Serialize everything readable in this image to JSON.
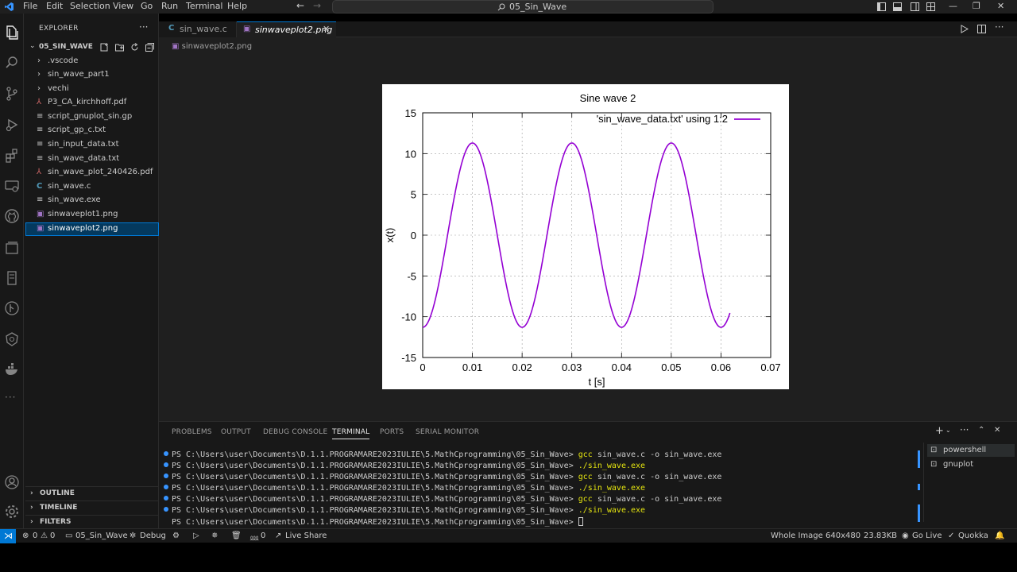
{
  "menu": [
    "File",
    "Edit",
    "Selection",
    "View",
    "Go",
    "Run",
    "Terminal",
    "Help"
  ],
  "title": "05_Sin_Wave",
  "explorer": {
    "header": "EXPLORER",
    "folder": "05_SIN_WAVE",
    "items": [
      {
        "label": ".vscode",
        "kind": "folder"
      },
      {
        "label": "sin_wave_part1",
        "kind": "folder"
      },
      {
        "label": "vechi",
        "kind": "folder"
      },
      {
        "label": "P3_CA_kirchhoff.pdf",
        "kind": "pdf"
      },
      {
        "label": "script_gnuplot_sin.gp",
        "kind": "text"
      },
      {
        "label": "script_gp_c.txt",
        "kind": "text"
      },
      {
        "label": "sin_input_data.txt",
        "kind": "text"
      },
      {
        "label": "sin_wave_data.txt",
        "kind": "text"
      },
      {
        "label": "sin_wave_plot_240426.pdf",
        "kind": "pdf"
      },
      {
        "label": "sin_wave.c",
        "kind": "c"
      },
      {
        "label": "sin_wave.exe",
        "kind": "text"
      },
      {
        "label": "sinwaveplot1.png",
        "kind": "image"
      },
      {
        "label": "sinwaveplot2.png",
        "kind": "image",
        "selected": true
      }
    ],
    "sections": [
      "OUTLINE",
      "TIMELINE",
      "FILTERS"
    ]
  },
  "tabs": [
    {
      "label": "sin_wave.c",
      "icon": "C"
    },
    {
      "label": "sinwaveplot2.png",
      "active": true
    }
  ],
  "breadcrumb": "sinwaveplot2.png",
  "chart_data": {
    "type": "line",
    "title": "Sine wave 2",
    "xlabel": "t [s]",
    "ylabel": "x(t)",
    "xlim": [
      0,
      0.07
    ],
    "ylim": [
      -15,
      15
    ],
    "xticks": [
      "0",
      "0.01",
      "0.02",
      "0.03",
      "0.04",
      "0.05",
      "0.06",
      "0.07"
    ],
    "yticks": [
      "15",
      "10",
      "5",
      "0",
      "-5",
      "-10",
      "-15"
    ],
    "grid": true,
    "legend_position": "top-right",
    "series": [
      {
        "name": "'sin_wave_data.txt' using 1:2",
        "color": "#9400d3",
        "amplitude": 11.3,
        "period": 0.02,
        "phase_start_value": -11.3,
        "x_end": 0.0618,
        "y_end": -9.0
      }
    ]
  },
  "panel_tabs": [
    "PROBLEMS",
    "OUTPUT",
    "DEBUG CONSOLE",
    "TERMINAL",
    "PORTS",
    "SERIAL MONITOR"
  ],
  "terminal": {
    "prompt": "PS C:\\Users\\user\\Documents\\D.1.1.PROGRAMARE2023IULIE\\5.MathCprogramming\\05_Sin_Wave>",
    "lines": [
      {
        "cmd": "gcc",
        "rest": " sin_wave.c -o sin_wave.exe"
      },
      {
        "cmd": "./sin_wave.exe",
        "rest": ""
      },
      {
        "cmd": "gcc",
        "rest": " sin_wave.c -o sin_wave.exe"
      },
      {
        "cmd": "./sin_wave.exe",
        "rest": ""
      },
      {
        "cmd": "gcc",
        "rest": " sin_wave.c -o sin_wave.exe"
      },
      {
        "cmd": "./sin_wave.exe",
        "rest": ""
      },
      {
        "cmd": "",
        "rest": ""
      }
    ],
    "sessions": [
      "powershell",
      "gnuplot"
    ]
  },
  "status": {
    "errors": "0",
    "warnings": "0",
    "workspace": "05_Sin_Wave",
    "debug": "Debug",
    "ports": "0",
    "live_share": "Live Share",
    "zoom": "Whole Image",
    "dimensions": "640x480",
    "size": "23.83KB",
    "go_live": "Go Live",
    "quokka": "Quokka"
  }
}
